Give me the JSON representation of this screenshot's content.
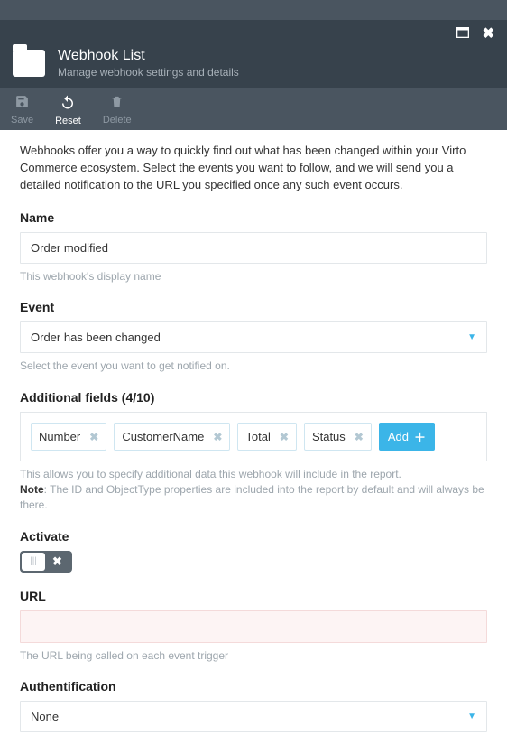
{
  "header": {
    "title": "Webhook List",
    "subtitle": "Manage webhook settings and details"
  },
  "toolbar": {
    "save": "Save",
    "reset": "Reset",
    "delete": "Delete"
  },
  "intro": "Webhooks offer you a way to quickly find out what has been changed within your Virto Commerce ecosystem. Select the events you want to follow, and we will send you a detailed notification to the URL you specified once any such event occurs.",
  "name": {
    "label": "Name",
    "value": "Order modified",
    "helper": "This webhook's display name"
  },
  "event": {
    "label": "Event",
    "value": "Order has been changed",
    "helper": "Select the event you want to get notified on."
  },
  "additional": {
    "label": "Additional fields (4/10)",
    "tags": [
      "Number",
      "CustomerName",
      "Total",
      "Status"
    ],
    "add": "Add",
    "helper1": "This allows you to specify additional data this webhook will include in the report.",
    "note_prefix": "Note",
    "helper2": ": The ID and ObjectType properties are included into the report by default and will always be there."
  },
  "activate": {
    "label": "Activate",
    "value": false
  },
  "url": {
    "label": "URL",
    "value": "",
    "helper": "The URL being called on each event trigger"
  },
  "auth": {
    "label": "Authentification",
    "value": "None"
  }
}
